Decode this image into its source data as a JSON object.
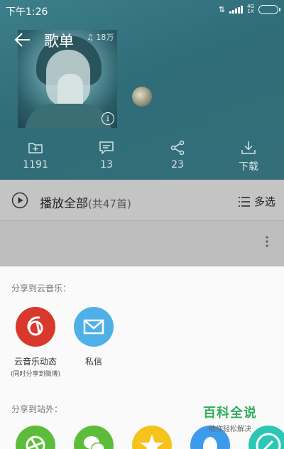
{
  "status_bar": {
    "time": "下午1:26",
    "network": "4G",
    "sub_network": "1X"
  },
  "header": {
    "title": "歌单",
    "play_count": "18万"
  },
  "actions": [
    {
      "label": "1191",
      "icon": "folder-add-icon"
    },
    {
      "label": "13",
      "icon": "comment-icon"
    },
    {
      "label": "23",
      "icon": "share-icon"
    },
    {
      "label": "下载",
      "icon": "download-icon"
    }
  ],
  "playbar": {
    "play_all": "播放全部",
    "count": "(共47首)",
    "multi_select": "多选"
  },
  "share_sheet": {
    "internal_title": "分享到云音乐：",
    "internal_items": [
      {
        "label": "云音乐动态",
        "sub": "(同时分享到微博)",
        "color": "#d9382c",
        "icon": "netease-music-icon"
      },
      {
        "label": "私信",
        "sub": "",
        "color": "#4fb0e8",
        "icon": "mail-icon"
      }
    ],
    "external_title": "分享到站外：",
    "external_items": [
      {
        "icon": "moments-icon",
        "color": "#5dbd3a"
      },
      {
        "icon": "wechat-icon",
        "color": "#5dbd3a"
      },
      {
        "icon": "qzone-icon",
        "color": "#f6c21c"
      },
      {
        "icon": "qq-icon",
        "color": "#3d9be9"
      },
      {
        "icon": "weibo-icon",
        "color": "#2bc6b4"
      }
    ]
  },
  "watermark": {
    "main": "百科全说",
    "sub": "助你轻松解决"
  }
}
